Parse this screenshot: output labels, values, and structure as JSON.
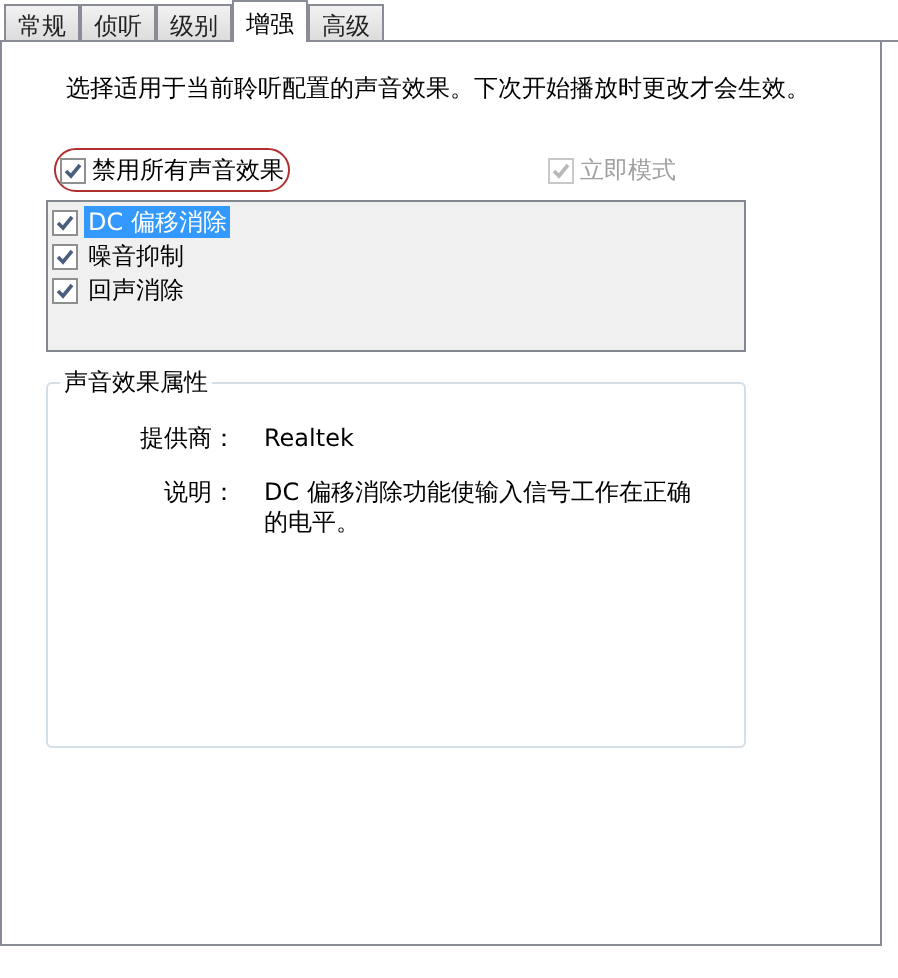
{
  "tabs": [
    {
      "label": "常规",
      "selected": false
    },
    {
      "label": "侦听",
      "selected": false
    },
    {
      "label": "级别",
      "selected": false
    },
    {
      "label": "增强",
      "selected": true
    },
    {
      "label": "高级",
      "selected": false
    }
  ],
  "description": "选择适用于当前聆听配置的声音效果。下次开始播放时更改才会生效。",
  "disable_all": {
    "label": "禁用所有声音效果",
    "checked": true,
    "highlighted": true
  },
  "immediate_mode": {
    "label": "立即模式",
    "checked": true,
    "disabled": true
  },
  "effects": [
    {
      "label": "DC 偏移消除",
      "checked": true,
      "selected": true
    },
    {
      "label": "噪音抑制",
      "checked": true,
      "selected": false
    },
    {
      "label": "回声消除",
      "checked": true,
      "selected": false
    }
  ],
  "properties": {
    "title": "声音效果属性",
    "rows": [
      {
        "label": "提供商：",
        "value": "Realtek"
      },
      {
        "label": "说明：",
        "value": "DC 偏移消除功能使输入信号工作在正确的电平。"
      }
    ]
  }
}
